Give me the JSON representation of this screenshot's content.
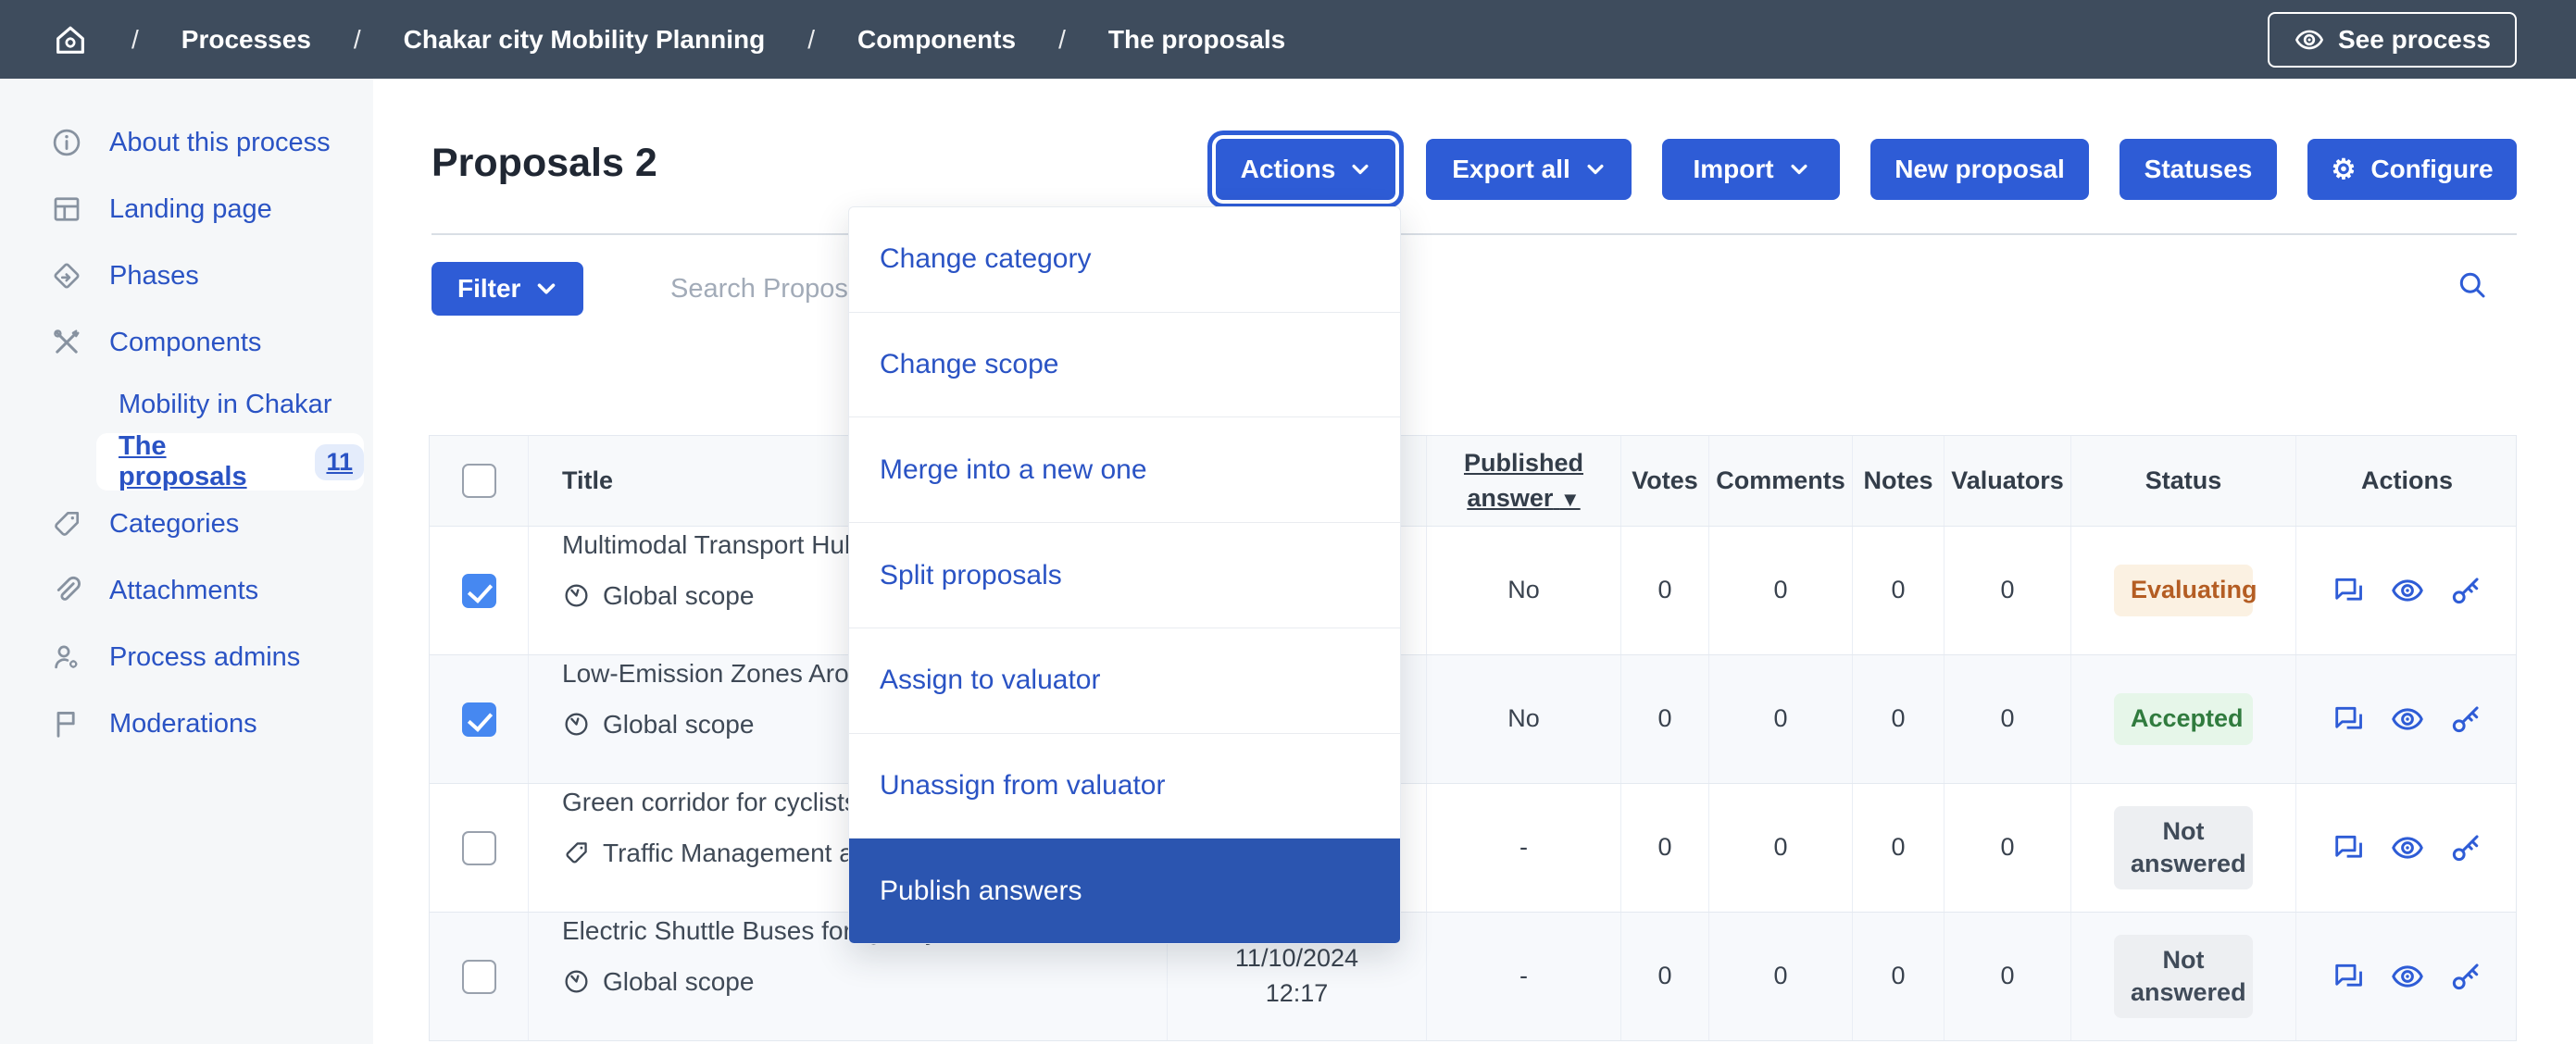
{
  "colors": {
    "navbar": "#3e4c5d",
    "primary_button": "#2e5cd6",
    "link_blue": "#2a53c4",
    "menu_highlight": "#2b55b0",
    "checkbox_checked": "#4688f1",
    "status_evaluating_text": "#b45d23",
    "status_evaluating_bg": "#fbf1e2",
    "status_accepted_text": "#307b3e",
    "status_accepted_bg": "#e6f6e9",
    "status_not_answered_text": "#404b59",
    "status_not_answered_bg": "#edeff2"
  },
  "breadcrumb": {
    "home_icon": "home-gear-icon",
    "separator": "/",
    "items": [
      "Processes",
      "Chakar city Mobility Planning",
      "Components",
      "The proposals"
    ],
    "see_process_label": "See process",
    "see_process_icon": "eye-icon"
  },
  "sidebar": {
    "items": [
      {
        "label": "About this process",
        "icon": "info-circle-icon"
      },
      {
        "label": "Landing page",
        "icon": "layout-icon"
      },
      {
        "label": "Phases",
        "icon": "phases-diamond-icon"
      },
      {
        "label": "Components",
        "icon": "tools-icon"
      },
      {
        "label": "Mobility in Chakar",
        "icon": null
      },
      {
        "label": "The proposals",
        "icon": null,
        "badge": "11",
        "active": true
      },
      {
        "label": "Categories",
        "icon": "tag-icon"
      },
      {
        "label": "Attachments",
        "icon": "paperclip-icon"
      },
      {
        "label": "Process admins",
        "icon": "user-gear-icon"
      },
      {
        "label": "Moderations",
        "icon": "flag-icon"
      }
    ]
  },
  "header": {
    "title": "Proposals 2"
  },
  "toolbar": {
    "actions_label": "Actions",
    "export_label": "Export all",
    "import_label": "Import",
    "new_proposal_label": "New proposal",
    "statuses_label": "Statuses",
    "configure_label": "Configure",
    "configure_icon": "gear-icon"
  },
  "filter_bar": {
    "filter_label": "Filter",
    "search_placeholder": "Search Propos",
    "search_icon": "search-icon"
  },
  "actions_menu": {
    "items": [
      "Change category",
      "Change scope",
      "Merge into a new one",
      "Split proposals",
      "Assign to valuator",
      "Unassign from valuator",
      "Publish answers"
    ],
    "highlighted_item": "Publish answers"
  },
  "table": {
    "headers": {
      "title": "Title",
      "published_answer": "Published answer",
      "sort_indicator": "▼",
      "votes": "Votes",
      "comments": "Comments",
      "notes": "Notes",
      "valuators": "Valuators",
      "status": "Status",
      "actions": "Actions"
    },
    "row_action_icons": [
      "answer-bubble-icon",
      "preview-eye-icon",
      "permissions-key-icon"
    ],
    "rows": [
      {
        "checked": true,
        "title": "Multimodal Transport Hubs",
        "meta": "Global scope",
        "meta_icon": "scope-icon",
        "published_at_date": "",
        "published_at_time": "",
        "published_answer": "No",
        "votes": "0",
        "comments": "0",
        "notes": "0",
        "valuators": "0",
        "status": "Evaluating",
        "status_color": "orange"
      },
      {
        "checked": true,
        "title": "Low-Emission Zones Around I",
        "meta": "Global scope",
        "meta_icon": "scope-icon",
        "published_at_date": "",
        "published_at_time": "",
        "published_answer": "No",
        "votes": "0",
        "comments": "0",
        "notes": "0",
        "valuators": "0",
        "status": "Accepted",
        "status_color": "green"
      },
      {
        "checked": false,
        "title": "Green corridor for cyclists and",
        "meta": "Traffic Management and S",
        "meta_icon": "tag-icon",
        "published_at_date": "",
        "published_at_time": "",
        "published_answer": "-",
        "votes": "0",
        "comments": "0",
        "notes": "0",
        "valuators": "0",
        "status": "Not answered",
        "status_color": "gray"
      },
      {
        "checked": false,
        "title": "Electric Shuttle Buses for Quarry Workers",
        "meta": "Global scope",
        "meta_icon": "scope-icon",
        "published_at_date": "11/10/2024",
        "published_at_time": "12:17",
        "published_answer": "-",
        "votes": "0",
        "comments": "0",
        "notes": "0",
        "valuators": "0",
        "status": "Not answered",
        "status_color": "gray"
      }
    ]
  }
}
